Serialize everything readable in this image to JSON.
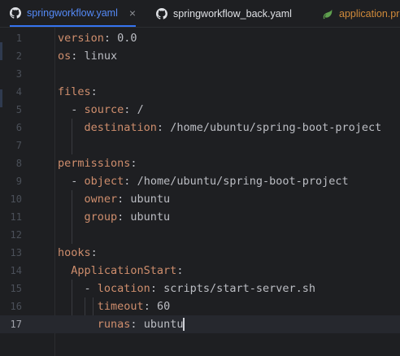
{
  "tabs": [
    {
      "label": "springworkflow.yaml",
      "icon": "github-icon",
      "active": true,
      "closable": true
    },
    {
      "label": "springworkflow_back.yaml",
      "icon": "github-icon",
      "active": false
    },
    {
      "label": "application.pro",
      "icon": "spring-icon",
      "active": false
    }
  ],
  "close_glyph": "×",
  "editor": {
    "current_line": 17,
    "lines": [
      {
        "n": "1",
        "key": "version",
        "sep": ": ",
        "value": "0.0"
      },
      {
        "n": "2",
        "key": "os",
        "sep": ": ",
        "value": "linux"
      },
      {
        "n": "3",
        "key": "",
        "sep": "",
        "value": ""
      },
      {
        "n": "4",
        "key": "files",
        "sep": ":",
        "value": ""
      },
      {
        "n": "5",
        "prefix": "  - ",
        "key": "source",
        "sep": ": ",
        "value": "/"
      },
      {
        "n": "6",
        "prefix": "    ",
        "key": "destination",
        "sep": ": ",
        "value": "/home/ubuntu/spring-boot-project"
      },
      {
        "n": "7",
        "key": "",
        "sep": "",
        "value": ""
      },
      {
        "n": "8",
        "key": "permissions",
        "sep": ":",
        "value": ""
      },
      {
        "n": "9",
        "prefix": "  - ",
        "key": "object",
        "sep": ": ",
        "value": "/home/ubuntu/spring-boot-project"
      },
      {
        "n": "10",
        "prefix": "    ",
        "key": "owner",
        "sep": ": ",
        "value": "ubuntu"
      },
      {
        "n": "11",
        "prefix": "    ",
        "key": "group",
        "sep": ": ",
        "value": "ubuntu"
      },
      {
        "n": "12",
        "key": "",
        "sep": "",
        "value": ""
      },
      {
        "n": "13",
        "key": "hooks",
        "sep": ":",
        "value": ""
      },
      {
        "n": "14",
        "prefix": "  ",
        "key": "ApplicationStart",
        "sep": ":",
        "value": ""
      },
      {
        "n": "15",
        "prefix": "    - ",
        "key": "location",
        "sep": ": ",
        "value": "scripts/start-server.sh"
      },
      {
        "n": "16",
        "prefix": "      ",
        "key": "timeout",
        "sep": ": ",
        "value": "60"
      },
      {
        "n": "17",
        "prefix": "      ",
        "key": "runas",
        "sep": ": ",
        "value": "ubuntu"
      }
    ]
  },
  "colors": {
    "background": "#1e1f22",
    "key": "#cf8e6d",
    "text": "#bcbec4",
    "line_number": "#4b5059",
    "active_tab": "#548af7",
    "accent": "#3574f0"
  }
}
